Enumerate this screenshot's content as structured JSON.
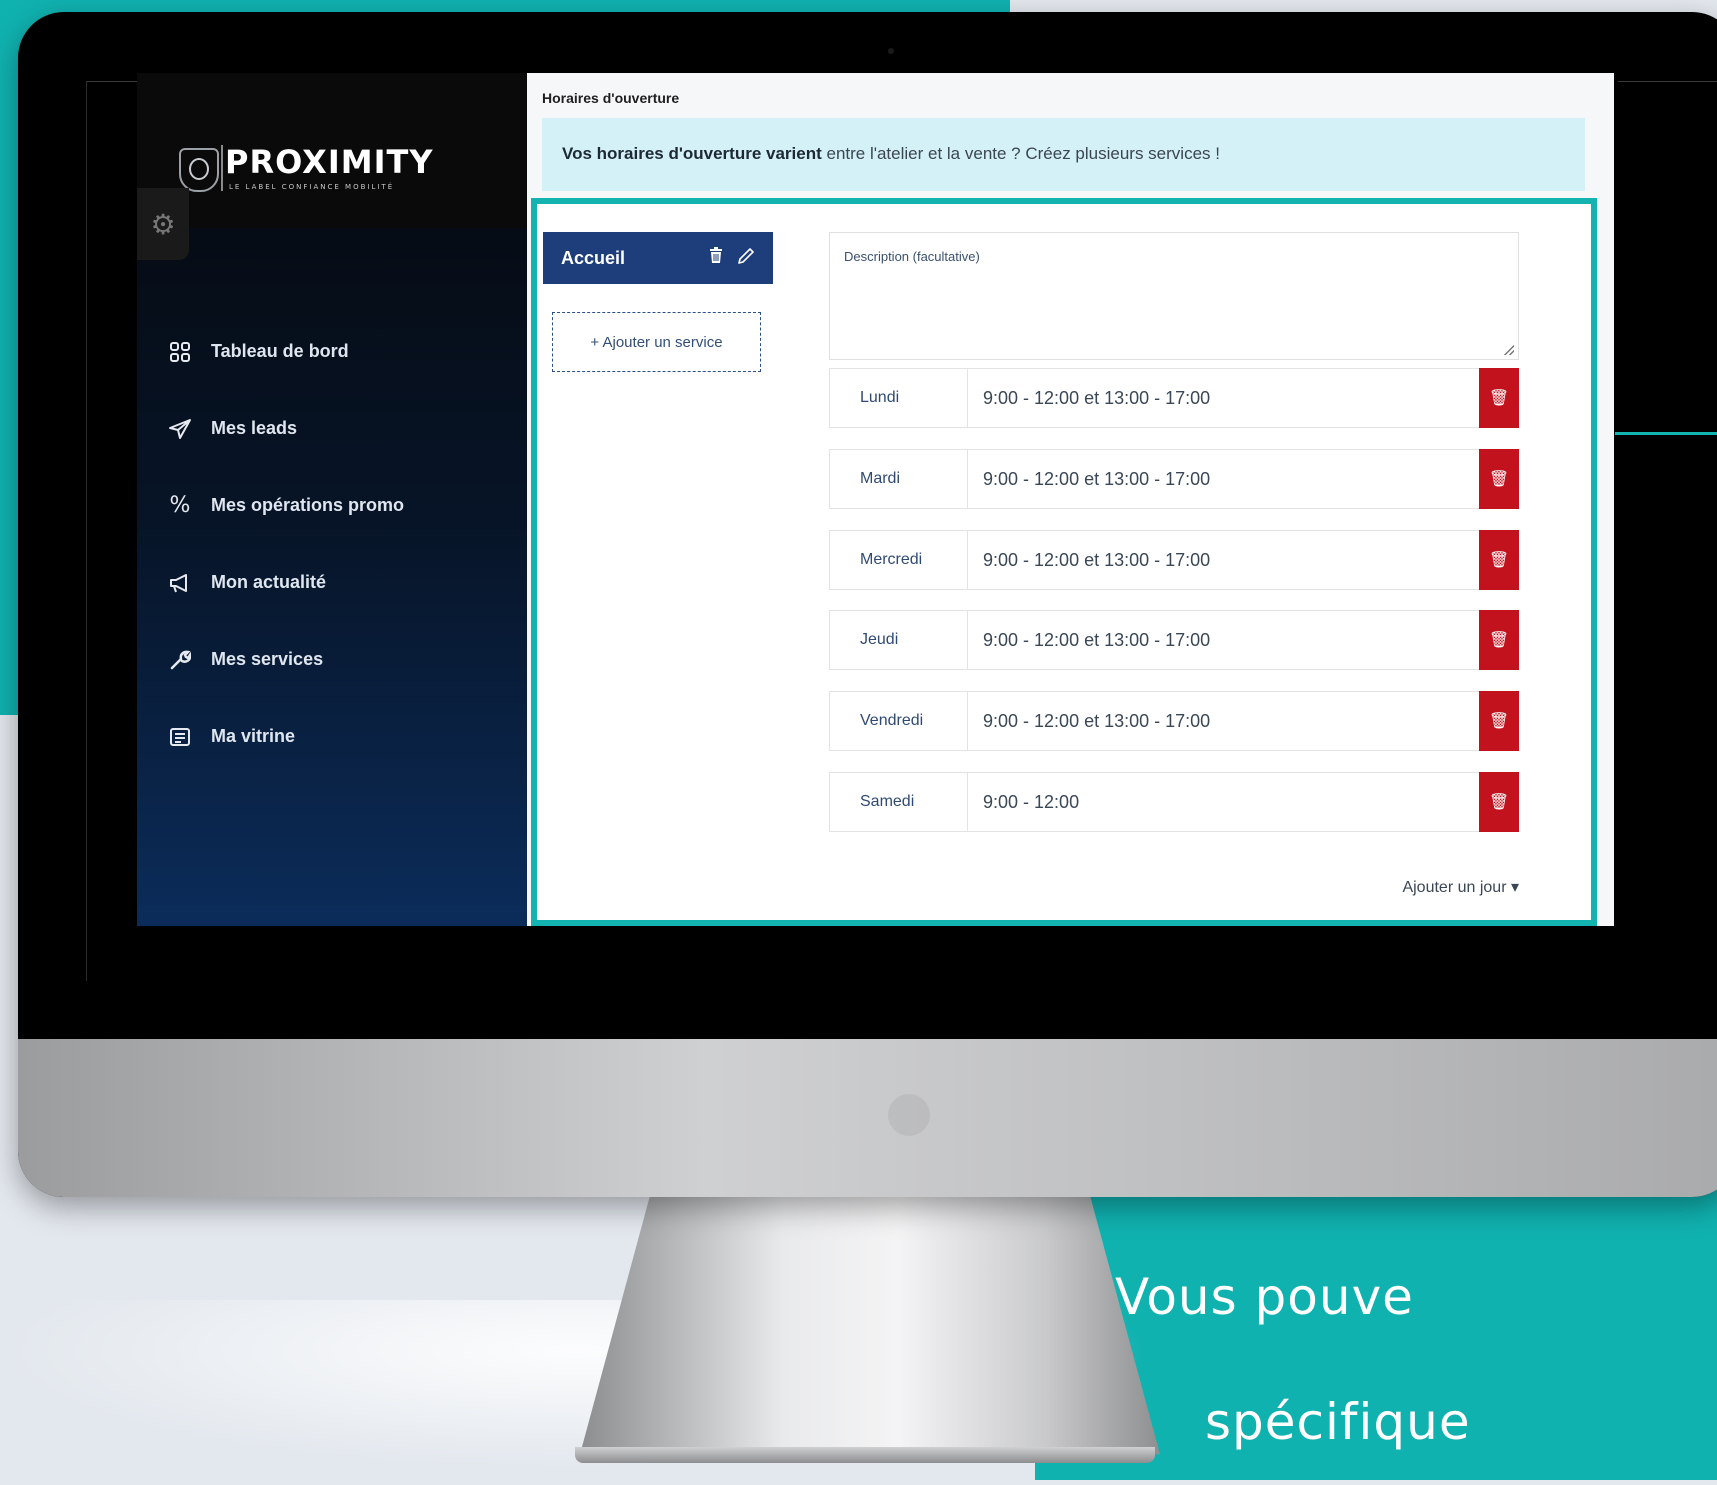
{
  "brand": {
    "name": "PROXIMITY",
    "subtitle": "LE LABEL CONFIANCE MOBILITÉ"
  },
  "sidebar": {
    "items": [
      {
        "label": "Tableau de bord",
        "icon": "grid-icon"
      },
      {
        "label": "Mes leads",
        "icon": "paper-plane-icon"
      },
      {
        "label": "Mes opérations promo",
        "icon": "percent-icon"
      },
      {
        "label": "Mon actualité",
        "icon": "megaphone-icon"
      },
      {
        "label": "Mes services",
        "icon": "wrench-icon"
      },
      {
        "label": "Ma vitrine",
        "icon": "document-icon"
      }
    ]
  },
  "main": {
    "section_title": "Horaires d'ouverture",
    "banner": {
      "bold": "Vos horaires d'ouverture varient",
      "rest": " entre l'atelier et la vente ? Créez plusieurs services !"
    },
    "service_tab": {
      "label": "Accueil"
    },
    "add_service_label": "+ Ajouter un service",
    "description_placeholder": "Description (facultative)",
    "days": [
      {
        "day": "Lundi",
        "hours": "9:00 - 12:00 et 13:00 - 17:00"
      },
      {
        "day": "Mardi",
        "hours": "9:00 - 12:00 et 13:00 - 17:00"
      },
      {
        "day": "Mercredi",
        "hours": "9:00 - 12:00 et 13:00 - 17:00"
      },
      {
        "day": "Jeudi",
        "hours": "9:00 - 12:00 et 13:00 - 17:00"
      },
      {
        "day": "Vendredi",
        "hours": "9:00 - 12:00 et 13:00 - 17:00"
      },
      {
        "day": "Samedi",
        "hours": "9:00 - 12:00"
      }
    ],
    "add_day_label": "Ajouter un jour ▾"
  },
  "tagline": {
    "line1": "Vous pouve",
    "line2": "spécifique"
  },
  "colors": {
    "teal": "#10b2b0",
    "navy": "#1e3d7b",
    "delete_red": "#c1121d",
    "banner_bg": "#d5f1f8"
  }
}
